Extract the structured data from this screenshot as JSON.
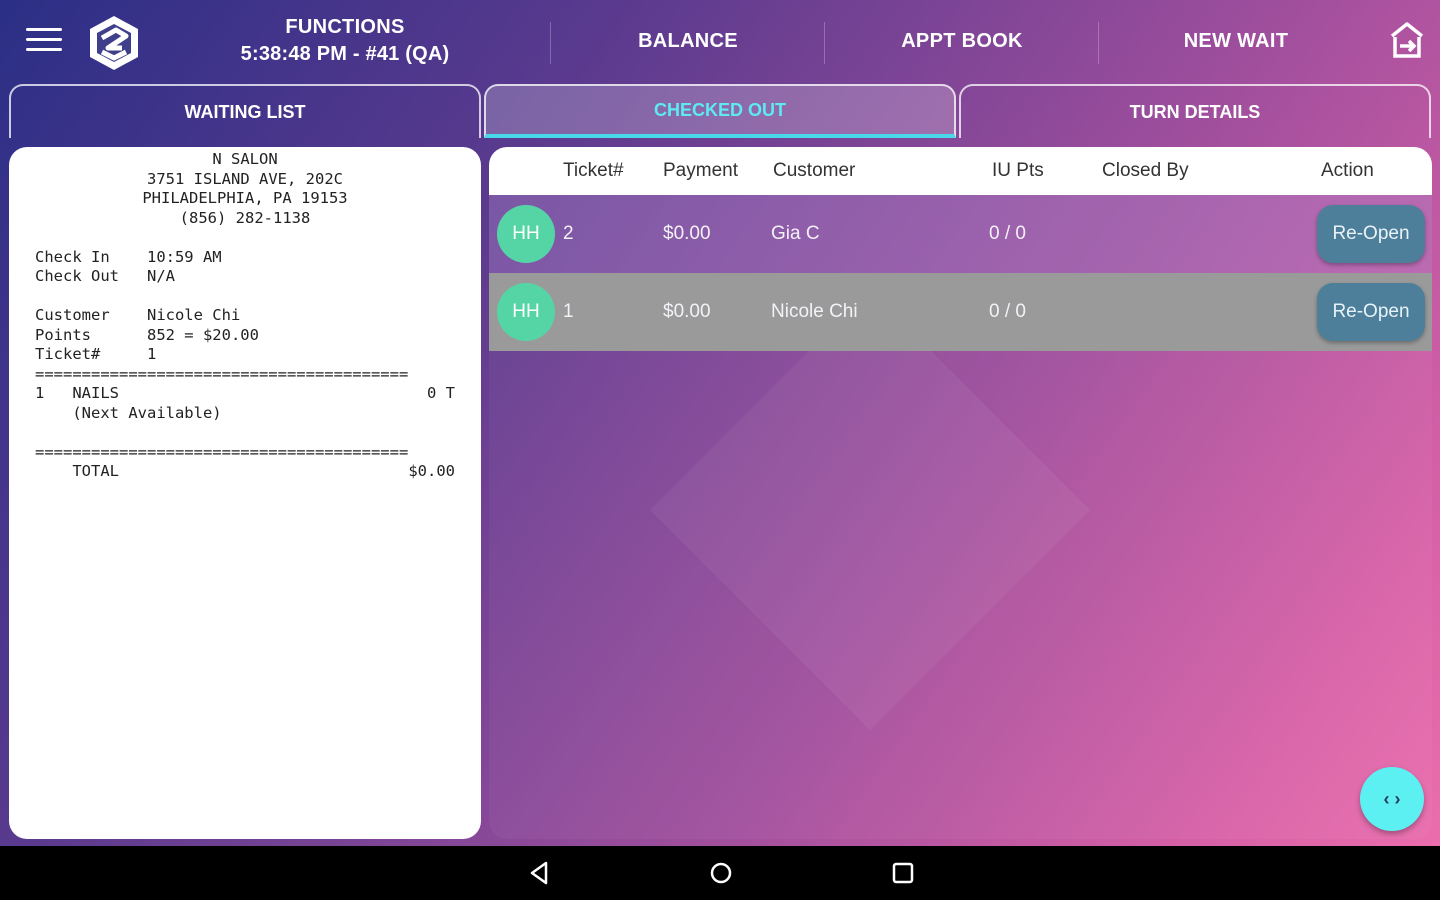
{
  "header": {
    "functions_label": "FUNCTIONS",
    "clock_line": "5:38:48 PM - #41 (QA)",
    "nav": [
      "BALANCE",
      "APPT BOOK",
      "NEW WAIT"
    ]
  },
  "tabs": [
    {
      "label": "WAITING LIST",
      "active": false
    },
    {
      "label": "CHECKED OUT",
      "active": true
    },
    {
      "label": "TURN DETAILS",
      "active": false
    }
  ],
  "receipt": {
    "salon": "N SALON",
    "address1": "3751 ISLAND AVE, 202C",
    "address2": "PHILADELPHIA, PA 19153",
    "phone": "(856) 282-1138",
    "check_in": "Check In    10:59 AM",
    "check_out": "Check Out   N/A",
    "customer": "Customer    Nicole Chi",
    "points": "Points      852 = $20.00",
    "ticket": "Ticket#     1",
    "separator": "========================================",
    "item_left": "1   NAILS",
    "item_right": "0 T",
    "item_note": "    (Next Available)",
    "total_label": "    TOTAL",
    "total_value": "$0.00"
  },
  "table": {
    "columns": [
      "Ticket#",
      "Payment",
      "Customer",
      "IU Pts",
      "Closed By",
      "Action"
    ],
    "rows": [
      {
        "avatar": "HH",
        "ticket": "2",
        "payment": "$0.00",
        "customer": "Gia C",
        "pts": "0 / 0",
        "closed_by": "",
        "action": "Re-Open"
      },
      {
        "avatar": "HH",
        "ticket": "1",
        "payment": "$0.00",
        "customer": "Nicole Chi",
        "pts": "0 / 0",
        "closed_by": "",
        "action": "Re-Open"
      }
    ]
  },
  "fab_label": "‹ ›",
  "colors": {
    "accent_cyan": "#5df0f2",
    "avatar_green": "#55d5a6",
    "reopen_button": "#4e7f9a",
    "selected_row": "#9a9a9a"
  }
}
